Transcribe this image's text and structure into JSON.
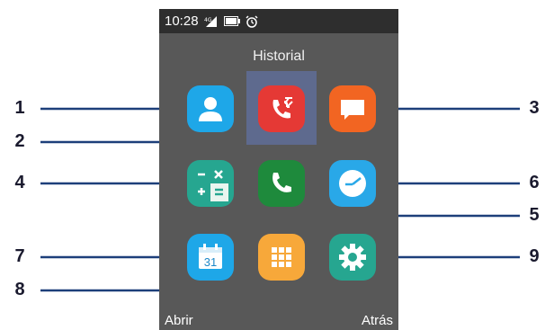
{
  "statusbar": {
    "time": "10:28"
  },
  "screen": {
    "title": "Historial"
  },
  "apps": [
    {
      "id": "contacts",
      "icon": "contact-person-icon",
      "color": "#1ea7e8"
    },
    {
      "id": "call-history",
      "icon": "call-history-icon",
      "color": "#e53935"
    },
    {
      "id": "messages",
      "icon": "message-icon",
      "color": "#f26522"
    },
    {
      "id": "calculator",
      "icon": "calculator-icon",
      "color": "#26a690"
    },
    {
      "id": "phone",
      "icon": "phone-icon",
      "color": "#1e8a3c"
    },
    {
      "id": "clock",
      "icon": "clock-icon",
      "color": "#29a8e8"
    },
    {
      "id": "calendar",
      "icon": "calendar-icon",
      "color": "#1ea7e8",
      "day": "31"
    },
    {
      "id": "apps-menu",
      "icon": "grid-icon",
      "color": "#f7a83a"
    },
    {
      "id": "settings",
      "icon": "gear-icon",
      "color": "#26a690"
    }
  ],
  "callouts": [
    "1",
    "2",
    "3",
    "4",
    "5",
    "6",
    "7",
    "8",
    "9"
  ],
  "softkeys": {
    "left": "Abrir",
    "right": "Atrás"
  }
}
